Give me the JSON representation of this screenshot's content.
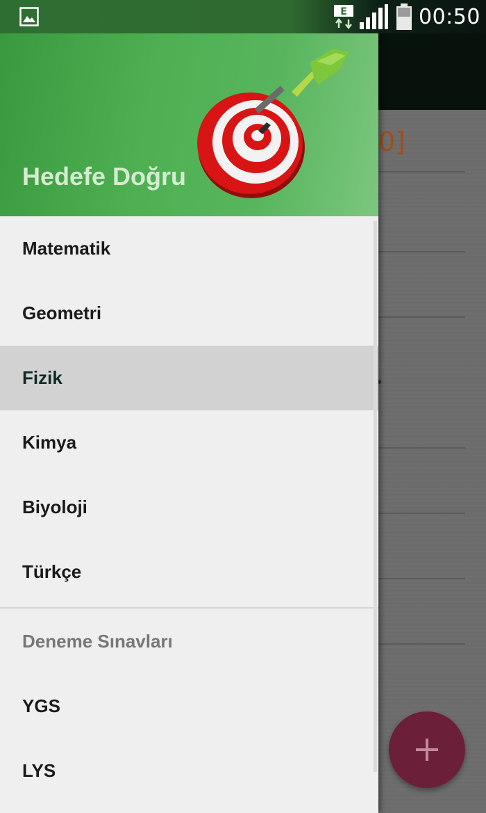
{
  "status_bar": {
    "gallery_icon": "image-icon",
    "data_icon": "mobile-data-e-icon",
    "data_label": "E",
    "signal_icon": "signal-icon",
    "battery_icon": "battery-icon",
    "time": "00:50"
  },
  "drawer": {
    "header_title": "Hedefe Doğru",
    "logo_icon": "dartboard-target-icon",
    "items": [
      {
        "label": "Matematik"
      },
      {
        "label": "Geometri"
      },
      {
        "label": "Fizik",
        "active": true
      },
      {
        "label": "Kimya"
      },
      {
        "label": "Biyoloji"
      },
      {
        "label": "Türkçe"
      }
    ],
    "section_title": "Deneme Sınavları",
    "exam_items": [
      {
        "label": "YGS"
      },
      {
        "label": "LYS"
      }
    ]
  },
  "background": {
    "partial_text": "0]",
    "fab_icon": "plus-icon"
  },
  "colors": {
    "header_green": "#4eb052",
    "active_item": "#d2d2d2",
    "fab": "#6b1f38",
    "drawer_bg": "#efefef"
  }
}
